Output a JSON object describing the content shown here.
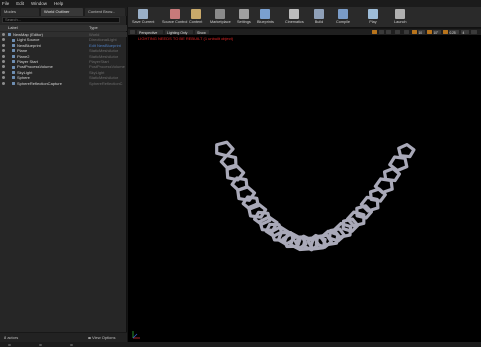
{
  "menu": [
    "File",
    "Edit",
    "Window",
    "Help"
  ],
  "left_tabs": [
    {
      "label": "Modes"
    },
    {
      "label": "World Outliner",
      "active": true
    },
    {
      "label": "Content Brow..."
    }
  ],
  "search": {
    "placeholder": "Search..."
  },
  "columns": {
    "label": "Label",
    "type": "Type"
  },
  "outliner_rows": [
    {
      "label": "NewMap (Editor)",
      "type": "World",
      "indent": 0,
      "link": false
    },
    {
      "label": "Light Source",
      "type": "DirectionalLight",
      "indent": 1,
      "link": false
    },
    {
      "label": "NewBlueprint",
      "type": "Edit NewBlueprint",
      "indent": 1,
      "link": true
    },
    {
      "label": "Plane",
      "type": "StaticMeshActor",
      "indent": 1,
      "link": false
    },
    {
      "label": "Plane2",
      "type": "StaticMeshActor",
      "indent": 1,
      "link": false
    },
    {
      "label": "Player Start",
      "type": "PlayerStart",
      "indent": 1,
      "link": false
    },
    {
      "label": "PostProcessVolume",
      "type": "PostProcessVolume",
      "indent": 1,
      "link": false
    },
    {
      "label": "SkyLight",
      "type": "SkyLight",
      "indent": 1,
      "link": false
    },
    {
      "label": "Sphere",
      "type": "StaticMeshActor",
      "indent": 1,
      "link": false
    },
    {
      "label": "SphereReflectionCapture",
      "type": "SphereReflectionC",
      "indent": 1,
      "link": false
    }
  ],
  "status": {
    "actor_count": "8 actors",
    "view_options": "View Options"
  },
  "toolbar": [
    {
      "label": "Save Current",
      "icon": "save-icon",
      "color": "#9ab0c8"
    },
    {
      "label": "Source Control",
      "icon": "source-control-icon",
      "color": "#c87a7a"
    },
    {
      "label": "Content",
      "icon": "content-icon",
      "color": "#c9a96a"
    },
    {
      "label": "Marketplace",
      "icon": "marketplace-icon",
      "color": "#8a8a8a"
    },
    {
      "label": "Settings",
      "icon": "settings-icon",
      "color": "#a0a0a0"
    },
    {
      "label": "Blueprints",
      "icon": "blueprints-icon",
      "color": "#7aa0d0"
    },
    {
      "label": "Cinematics",
      "icon": "cinematics-icon",
      "color": "#bdbdbd"
    },
    {
      "label": "Build",
      "icon": "build-icon",
      "color": "#8fa0b8"
    },
    {
      "label": "Compile",
      "icon": "compile-icon",
      "color": "#7a9cc8"
    },
    {
      "label": "Play",
      "icon": "play-icon",
      "color": "#9dbcd8"
    },
    {
      "label": "Launch",
      "icon": "launch-icon",
      "color": "#b0b0b0"
    }
  ],
  "viewport": {
    "perspective": "Perspective",
    "lighting": "Lighting Only",
    "show": "Show",
    "grid_size": "10",
    "snap_angle": "10°",
    "snap_scale": "0.25",
    "camera_speed": "4",
    "warning": "LIGHTING NEEDS TO BE REBUILT (1 unbuilt object)"
  },
  "colors": {
    "accent": "#b8741c",
    "warning": "#e02424",
    "link": "#4e7fc3",
    "chain": "#a9a9b8"
  }
}
